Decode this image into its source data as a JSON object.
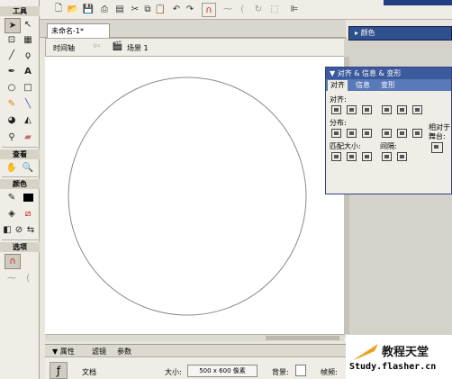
{
  "toolbox": {
    "tools_label": "工具",
    "view_label": "查看",
    "colors_label": "颜色",
    "options_label": "选项"
  },
  "document": {
    "tab_label": "未命名-1*"
  },
  "timeline": {
    "timeline_label": "时间轴",
    "scene_label": "场景 1"
  },
  "color_panel": {
    "title": "颜色"
  },
  "align_panel": {
    "title": "▼ 对齐 & 信息 & 变形",
    "tabs": [
      "对齐",
      "信息",
      "变形"
    ],
    "align_label": "对齐:",
    "distribute_label": "分布:",
    "match_size_label": "匹配大小:",
    "spacing_label": "间隔:",
    "relative_label": "相对于",
    "stage_label": "舞台:"
  },
  "properties": {
    "tabs": [
      "▼ 属性",
      "滤镜",
      "参数"
    ],
    "doc_label": "文档",
    "size_label": "大小:",
    "size_value": "500 x 600 像素",
    "bg_label": "背景:",
    "fps_label": "帧频:"
  },
  "watermark": {
    "title": "教程天堂",
    "url": "Study.flasher.cn"
  },
  "colors": {
    "panel_blue": "#3c5b9c",
    "stage_stroke": "#8a8a8a"
  }
}
